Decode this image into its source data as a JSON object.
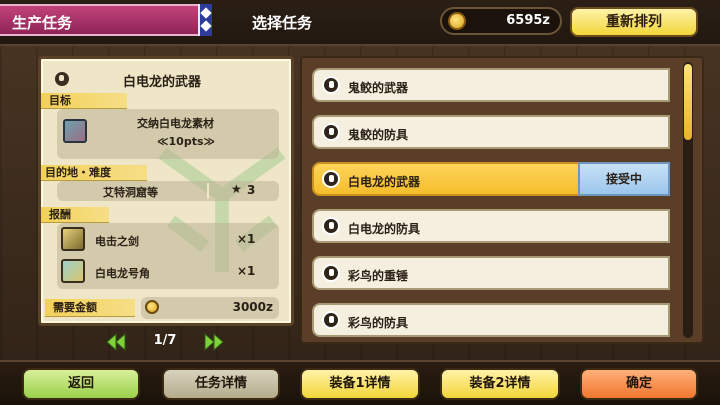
{
  "header": {
    "title": "生产任务",
    "subtitle": "选择任务",
    "money": "6595z",
    "resort_label": "重新排列"
  },
  "detail": {
    "quest_name": "白电龙的武器",
    "target_label": "目标",
    "target_line1": "交纳白电龙素材",
    "target_line2": "≪10pts≫",
    "destination_label": "目的地・难度",
    "destination": "艾特洞窟等",
    "difficulty": "3",
    "reward_label": "报酬",
    "rewards": [
      {
        "name": "电击之剑",
        "qty": "×1"
      },
      {
        "name": "白电龙号角",
        "qty": "×1"
      }
    ],
    "cost_label": "需要金额",
    "cost_value": "3000z"
  },
  "pager": {
    "text": "1/7"
  },
  "quest_list": {
    "items": [
      {
        "label": "鬼鲛的武器"
      },
      {
        "label": "鬼鲛的防具"
      },
      {
        "label": "白电龙的武器"
      },
      {
        "label": "白电龙的防具"
      },
      {
        "label": "彩鸟的重锤"
      },
      {
        "label": "彩鸟的防具"
      }
    ],
    "accepted_badge": "接受中",
    "selected_index": 2
  },
  "bottom": {
    "back": "返回",
    "details": "任务详情",
    "equip1": "装备1详情",
    "equip2": "装备2详情",
    "confirm": "确定"
  },
  "colors": {
    "title_tab": "#a8336a",
    "selected_item": "#f4bd2c",
    "accepted_badge": "#9cc6ec",
    "confirm_button": "#f0772f",
    "back_button": "#9ad04a"
  },
  "icons": [
    "coin-icon",
    "quest-icon",
    "star-icon",
    "arrow-left-icon",
    "arrow-right-icon"
  ]
}
